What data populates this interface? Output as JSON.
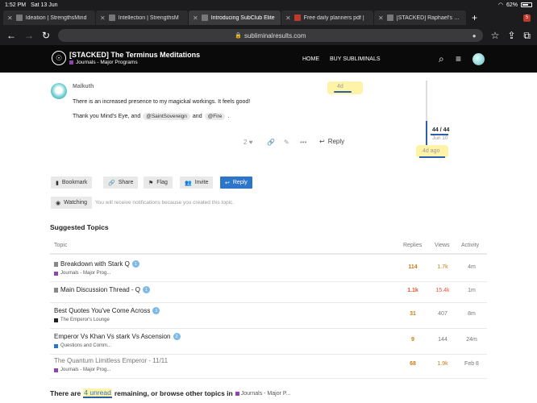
{
  "status": {
    "time": "1:52 PM",
    "date": "Sat 13 Jun",
    "battery": "62%",
    "battery_level": 0.62
  },
  "tabs": [
    {
      "title": "Ideation | StrengthsMind",
      "active": false
    },
    {
      "title": "Intellection | StrengthsM",
      "active": false
    },
    {
      "title": "Introducing SubClub Elite",
      "active": true
    },
    {
      "title": "Free daily planners pdf |",
      "active": false
    },
    {
      "title": "[STACKED] Raphael's Sta",
      "active": false
    }
  ],
  "tab_count": "5",
  "url": "subliminalresults.com",
  "site": {
    "title": "[STACKED] The Terminus Meditations",
    "category": "Journals - Major Programs",
    "category_color": "#8e44ad",
    "nav": [
      "HOME",
      "BUY SUBLIMINALS"
    ]
  },
  "post": {
    "username": "Malkuth",
    "date": "4d",
    "text1": "There is an increased presence to my magickal workings. It feels good!",
    "text2_prefix": "Thank you Mind's Eye, and",
    "mention1": "@SaintSovereign",
    "and": "and",
    "mention2": "@Fire",
    "period": ".",
    "likes": "2",
    "reply_label": "Reply"
  },
  "timeline": {
    "count": "44 / 44",
    "date": "Jun 10",
    "ago": "4d ago"
  },
  "footer_buttons": {
    "bookmark": "Bookmark",
    "share": "Share",
    "flag": "Flag",
    "invite": "Invite",
    "reply": "Reply"
  },
  "notifications": {
    "level": "Watching",
    "description": "You will receive notifications because you created this topic."
  },
  "suggested": {
    "title": "Suggested Topics",
    "headers": {
      "topic": "Topic",
      "replies": "Replies",
      "views": "Views",
      "activity": "Activity"
    },
    "rows": [
      {
        "title": "Breakdown with Stark Q",
        "badge": "1",
        "category": "Journals - Major Prog...",
        "cat_color": "#8e44ad",
        "replies": "114",
        "views": "1.7k",
        "activity": "4m",
        "replies_color": "#c77d16",
        "views_color": "#c77d16",
        "pinned": true,
        "visited": false
      },
      {
        "title": "Main Discussion Thread - Q",
        "badge": "1",
        "category": "",
        "cat_color": "#8e44ad",
        "replies": "1.1k",
        "views": "15.4k",
        "activity": "1m",
        "replies_color": "#e45735",
        "views_color": "#e45735",
        "pinned": true,
        "visited": false
      },
      {
        "title": "Best Quotes You've Come Across",
        "badge": "1",
        "category": "The Emperor's Lounge",
        "cat_color": "#222222",
        "replies": "31",
        "views": "407",
        "activity": "8m",
        "replies_color": "#c77d16",
        "views_color": "#777777",
        "pinned": false,
        "visited": false
      },
      {
        "title": "Emperor Vs Khan Vs stark Vs Ascension",
        "badge": "2",
        "category": "Questions and Comm...",
        "cat_color": "#2d75c9",
        "replies": "9",
        "views": "144",
        "activity": "24m",
        "replies_color": "#c77d16",
        "views_color": "#777777",
        "pinned": false,
        "visited": false
      },
      {
        "title": "The Quantum Limitless Emperor - 11/11",
        "badge": "",
        "category": "Journals - Major Prog...",
        "cat_color": "#8e44ad",
        "replies": "68",
        "views": "1.9k",
        "activity": "Feb 8",
        "replies_color": "#c77d16",
        "views_color": "#c77d16",
        "pinned": false,
        "visited": true
      }
    ]
  },
  "bottom": {
    "prefix": "There are",
    "unread": "4 unread",
    "suffix": "remaining, or browse other topics in",
    "category": "Journals - Major P..."
  },
  "colors": {
    "accent": "#2d75c9",
    "highlight": "#fff3a8",
    "underline": "#2d5ea9"
  },
  "icons": [
    "back-arrow-icon",
    "forward-arrow-icon",
    "reload-icon",
    "lock-icon",
    "mic-icon",
    "star-icon",
    "share-icon",
    "tabs-icon",
    "search-icon",
    "hamburger-icon",
    "heart-icon",
    "link-icon",
    "edit-icon",
    "more-icon",
    "reply-icon",
    "bookmark-icon",
    "flag-icon",
    "invite-icon",
    "watching-icon",
    "pin-icon"
  ]
}
